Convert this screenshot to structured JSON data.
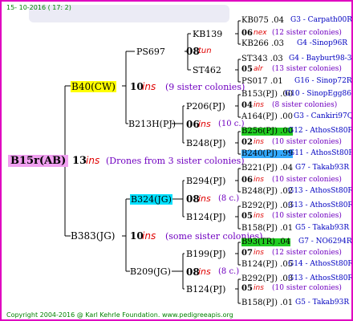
{
  "header": {
    "date": "15- 10-2016 ( 17:  2)"
  },
  "footer": {
    "text": "Copyright 2004-2016 @ Karl Kehrle Foundation.   www.pedigreeapis.org"
  },
  "root": {
    "label": "B15r(AB)",
    "num": "13",
    "ins": "ins",
    "note": "(Drones from 3 sister colonies)"
  },
  "gen1": [
    {
      "label": "B40(CW)",
      "num": "10",
      "ins": "ins",
      "note": "(9 sister colonies)"
    },
    {
      "label": "B383(JG)",
      "num": "10",
      "ins": "ins",
      "note": "(some sister colonies)"
    }
  ],
  "gen2": [
    {
      "label": "PS697",
      "num": "08",
      "ins": "tun"
    },
    {
      "label": "B213H(PJ)",
      "num": "06",
      "ins": "ins",
      "note": "(10 c.)"
    },
    {
      "label": "B324(JG)",
      "num": "08",
      "ins": "ins",
      "note": "(8 c.)"
    },
    {
      "label": "B209(JG)",
      "num": "08",
      "ins": "ins",
      "note": "(8 c.)"
    }
  ],
  "gen3": [
    {
      "label": "KB139",
      "num": "06",
      "ins": "nex",
      "note": "(12 sister colonies)"
    },
    {
      "label": "ST462",
      "num": "05",
      "ins": "alr",
      "note": "(13 sister colonies)"
    },
    {
      "label": "P206(PJ)",
      "num": "04",
      "ins": "ins",
      "note": "(8 sister colonies)"
    },
    {
      "label": "B248(PJ)",
      "num": "02",
      "ins": "ins",
      "note": "(10 sister colonies)"
    },
    {
      "label": "B294(PJ)",
      "num": "06",
      "ins": "ins",
      "note": "(10 sister colonies)"
    },
    {
      "label": "B124(PJ)",
      "num": "05",
      "ins": "ins",
      "note": "(10 sister colonies)"
    },
    {
      "label": "B199(PJ)",
      "num": "07",
      "ins": "ins",
      "note": "(12 sister colonies)"
    },
    {
      "label": "B124(PJ)",
      "num": "05",
      "ins": "ins",
      "note": "(10 sister colonies)"
    }
  ],
  "gen4": [
    {
      "id": "KB075 .04",
      "line": "G3 - Carpath00R"
    },
    {
      "id": "KB266 .03",
      "line": "G4 -Sinop96R"
    },
    {
      "id": "ST343 .03",
      "line": "G4 - Bayburt98-3"
    },
    {
      "id": "PS017 .01",
      "line": "G16 - Sinop72R"
    },
    {
      "id": "B153(PJ) .00",
      "line": "G10 - SinopEgg86R"
    },
    {
      "id": "A164(PJ) .00",
      "line": "G3 - Cankiri97Q"
    },
    {
      "id": "B256(PJ) .00",
      "line": "G12 - AthosSt80R"
    },
    {
      "id": "B240(PJ) .99",
      "line": "G11 - AthosSt80R"
    },
    {
      "id": "B221(PJ) .04",
      "line": "G7 - Takab93R"
    },
    {
      "id": "B248(PJ) .02",
      "line": "G13 - AthosSt80R"
    },
    {
      "id": "B292(PJ) .03",
      "line": "G13 - AthosSt80R"
    },
    {
      "id": "B158(PJ) .01",
      "line": "G5 - Takab93R"
    },
    {
      "id": "B93(TR) .04",
      "line": "G7 - NO6294R"
    },
    {
      "id": "B124(PJ) .05",
      "line": "G14 - AthosSt80R"
    },
    {
      "id": "B292(PJ) .03",
      "line": "G13 - AthosSt80R"
    },
    {
      "id": "B158(PJ) .01",
      "line": "G5 - Takab93R"
    }
  ]
}
